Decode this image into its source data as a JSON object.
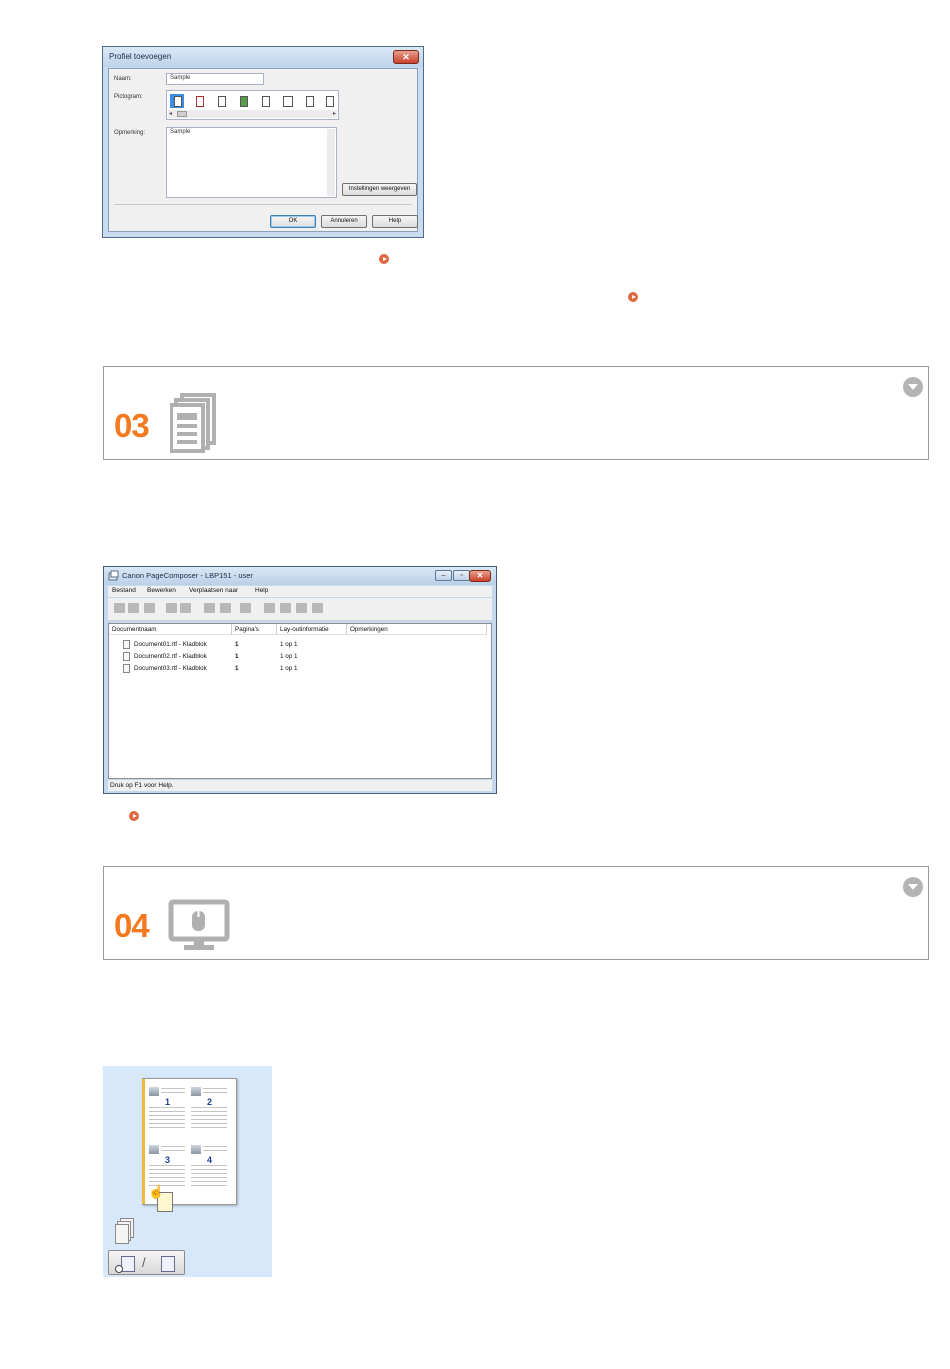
{
  "dialog": {
    "title": "Profiel toevoegen",
    "close_glyph": "✕",
    "name_label": "Naam:",
    "name_value": "Sample",
    "pictogram_label": "Pictogram:",
    "comment_label": "Opmerking:",
    "comment_value": "Sample",
    "settings_button": "Instellingen weergeven",
    "ok_button": "OK",
    "cancel_button": "Annuleren",
    "help_button": "Help",
    "pictograms": [
      "doc-icon",
      "doc-red-icon",
      "doc-cross-icon",
      "photo-icon",
      "doc-portrait-icon",
      "booklet-icon",
      "doc-edit-icon",
      "duplex-icon"
    ]
  },
  "steps": [
    {
      "number": "03",
      "icon": "pages-stack-icon"
    },
    {
      "number": "04",
      "icon": "monitor-mouse-icon"
    }
  ],
  "composer": {
    "title": "Canon PageComposer - LBP151 - user",
    "menus": [
      "Bestand",
      "Bewerken",
      "Verplaatsen naar",
      "Help"
    ],
    "columns": [
      "Documentnaam",
      "Pagina's",
      "Lay-outinformatie",
      "Opmerkingen"
    ],
    "rows": [
      {
        "name": "Document01.rtf - Kladblok",
        "pages": "1",
        "layout": "1 op 1",
        "comment": ""
      },
      {
        "name": "Document02.rtf - Kladblok",
        "pages": "1",
        "layout": "1 op 1",
        "comment": ""
      },
      {
        "name": "Document03.rtf - Kladblok",
        "pages": "1",
        "layout": "1 op 1",
        "comment": ""
      }
    ],
    "status": "Druk op F1 voor Help."
  },
  "preview": {
    "page_numbers": [
      "1",
      "2",
      "3",
      "4"
    ]
  },
  "colors": {
    "step_number": "#f47920",
    "link_marker": "#e06840",
    "preview_bg": "#d6e8fa"
  }
}
